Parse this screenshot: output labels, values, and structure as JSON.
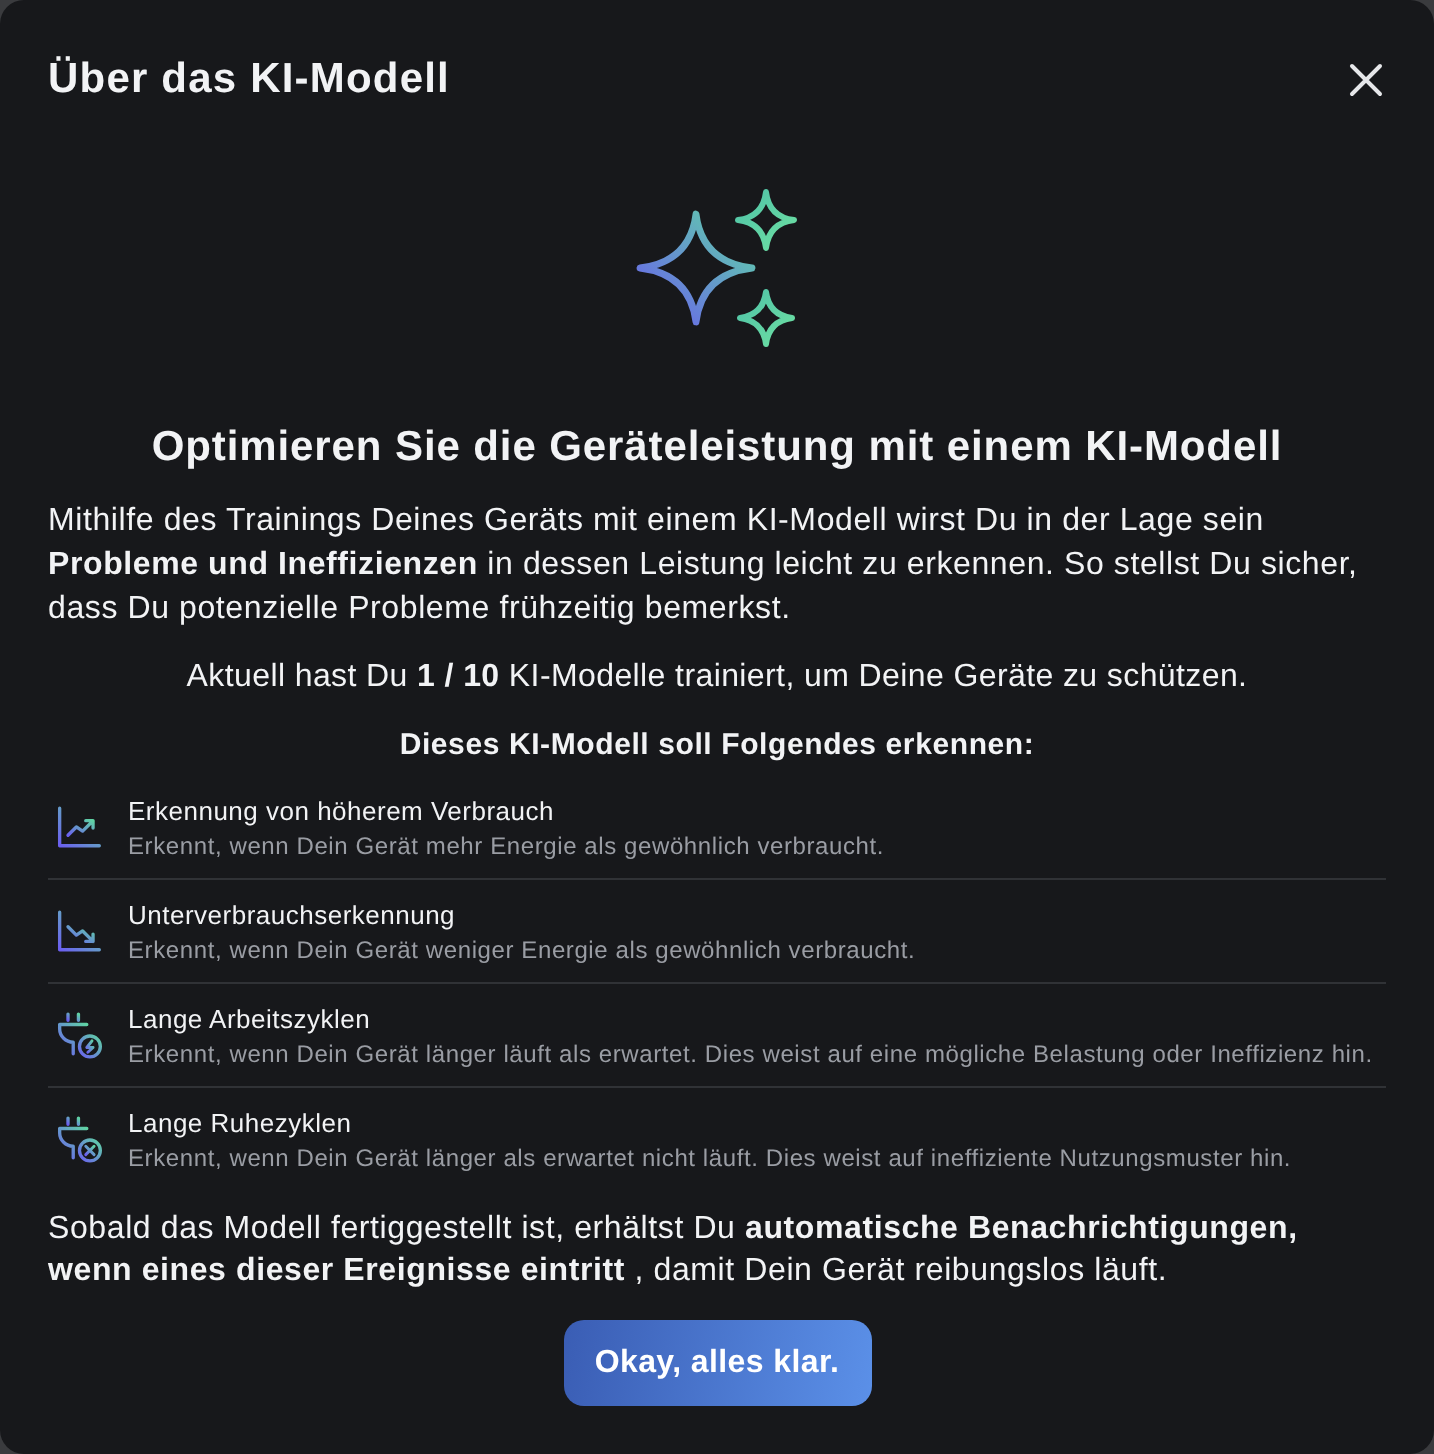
{
  "dialog": {
    "title": "Über das KI-Modell"
  },
  "headline": "Optimieren Sie die Geräteleistung mit einem KI-Modell",
  "intro": "Mithilfe des Trainings Deines Geräts mit einem KI-Modell wirst Du in der Lage sein **Probleme und Ineffizienzen** in dessen Leistung leicht zu erkennen. So stellst Du sicher, dass Du potenzielle Probleme frühzeitig bemerkst.",
  "progress_text": "Aktuell hast Du **1 / 10** KI-Modelle trainiert, um Deine Geräte zu schützen.",
  "features_heading": "Dieses KI-Modell soll Folgendes erkennen:",
  "features": [
    {
      "kind": "increase",
      "title": "Erkennung von höherem Verbrauch",
      "description": "Erkennt, wenn Dein Gerät mehr Energie als gewöhnlich verbraucht."
    },
    {
      "kind": "decrease",
      "title": "Unterverbrauchserkennung",
      "description": "Erkennt, wenn Dein Gerät weniger Energie als gewöhnlich verbraucht."
    },
    {
      "kind": "long-run",
      "title": "Lange Arbeitszyklen",
      "description": "Erkennt, wenn Dein Gerät länger läuft als erwartet. Dies weist auf eine mögliche Belastung oder Ineffizienz hin."
    },
    {
      "kind": "long-idle",
      "title": "Lange Ruhezyklen",
      "description": "Erkennt, wenn Dein Gerät länger als erwartet nicht läuft. Dies weist auf ineffiziente Nutzungsmuster hin."
    }
  ],
  "closing": "Sobald das Modell fertiggestellt ist, erhältst Du **automatische Benachrichtigungen, wenn eines dieser Ereignisse eintritt** , damit Dein Gerät reibungslos läuft.",
  "button": "Okay, alles klar."
}
